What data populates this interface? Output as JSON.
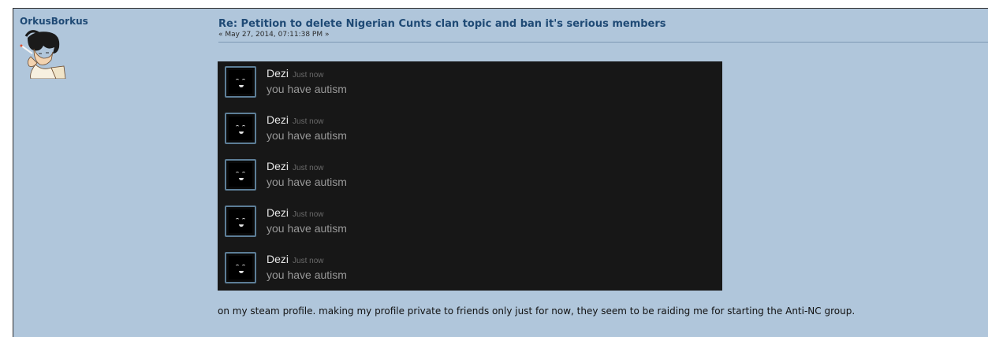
{
  "poster": {
    "name": "OrkusBorkus"
  },
  "post": {
    "subject": "Re: Petition to delete Nigerian Cunts clan topic and ban it's serious members",
    "date": "« May 27, 2014, 07:11:38 PM »",
    "body": "on my steam profile.  making my profile private to friends only just for now, they seem to be raiding me for starting the Anti-NC group."
  },
  "chat_messages": [
    {
      "name": "Dezi",
      "time": "Just now",
      "text": "you have autism"
    },
    {
      "name": "Dezi",
      "time": "Just now",
      "text": "you have autism"
    },
    {
      "name": "Dezi",
      "time": "Just now",
      "text": "you have autism"
    },
    {
      "name": "Dezi",
      "time": "Just now",
      "text": "you have autism"
    },
    {
      "name": "Dezi",
      "time": "Just now",
      "text": "you have autism"
    }
  ],
  "colors": {
    "post_background": "#b0c6db",
    "link": "#1f4a75",
    "chat_background": "#171717"
  }
}
